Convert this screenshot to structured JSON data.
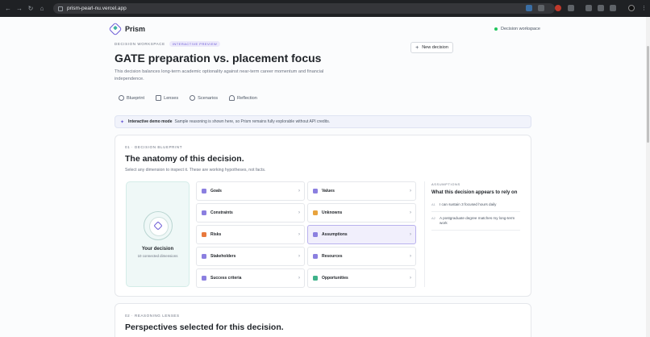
{
  "browser": {
    "url": "prism-pearl-nu.vercel.app"
  },
  "header": {
    "brand": "Prism",
    "status": "Decision workspace"
  },
  "decision": {
    "eyebrow": "DECISION WORKSPACE",
    "pill": "INTERACTIVE PREVIEW",
    "new_button": "New decision",
    "title": "GATE preparation vs. placement focus",
    "description": "This decision balances long-term academic optionality against near-term career momentum and financial independence."
  },
  "tabs": [
    {
      "label": "Blueprint",
      "icon": "blueprint-icon"
    },
    {
      "label": "Lenses",
      "icon": "lenses-icon"
    },
    {
      "label": "Scenarios",
      "icon": "scenarios-icon"
    },
    {
      "label": "Reflection",
      "icon": "reflection-icon"
    }
  ],
  "banner": {
    "title": "Interactive demo mode",
    "text": "Sample reasoning is shown here, so Prism remains fully explorable without API credits."
  },
  "blueprint": {
    "eyebrow": "01 · DECISION BLUEPRINT",
    "title": "The anatomy of this decision.",
    "subtitle": "Select any dimension to inspect it. These are working hypotheses, not facts.",
    "hub_title": "Your decision",
    "hub_count": "10 connected dimensions",
    "dimensions": [
      {
        "label": "Goals",
        "color": "#8b7fe0"
      },
      {
        "label": "Values",
        "color": "#8b7fe0"
      },
      {
        "label": "Constraints",
        "color": "#8b7fe0"
      },
      {
        "label": "Unknowns",
        "color": "#e8a33d"
      },
      {
        "label": "Risks",
        "color": "#e8793d"
      },
      {
        "label": "Assumptions",
        "color": "#8b7fe0"
      },
      {
        "label": "Stakeholders",
        "color": "#8b7fe0"
      },
      {
        "label": "Resources",
        "color": "#8b7fe0"
      },
      {
        "label": "Success criteria",
        "color": "#8b7fe0"
      },
      {
        "label": "Opportunities",
        "color": "#3fb28a"
      }
    ],
    "aside": {
      "eyebrow": "ASSUMPTIONS",
      "title": "What this decision appears to rely on",
      "items": [
        {
          "id": "A1",
          "text": "I can sustain 3 focused hours daily"
        },
        {
          "id": "A2",
          "text": "A postgraduate degree matches my long-term work"
        }
      ]
    }
  },
  "lenses": {
    "eyebrow": "02 · REASONING LENSES",
    "title": "Perspectives selected for this decision."
  }
}
